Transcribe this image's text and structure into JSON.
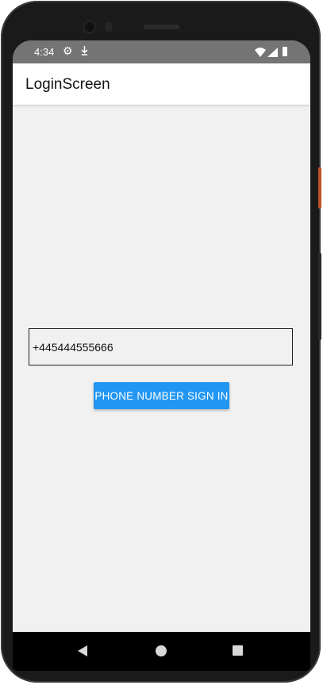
{
  "status_bar": {
    "time": "4:34",
    "icons": [
      "gear-icon",
      "download-icon",
      "wifi-icon",
      "signal-icon",
      "battery-icon"
    ]
  },
  "app_bar": {
    "title": "LoginScreen"
  },
  "login": {
    "phone_value": "+445444555666",
    "signin_label": "PHONE NUMBER SIGN IN"
  },
  "nav_bar": {
    "icons": [
      "back-icon",
      "home-icon",
      "recents-icon"
    ]
  },
  "colors": {
    "accent": "#2196f3",
    "screen_background": "#f1f1f1",
    "status_bar": "#747474"
  }
}
